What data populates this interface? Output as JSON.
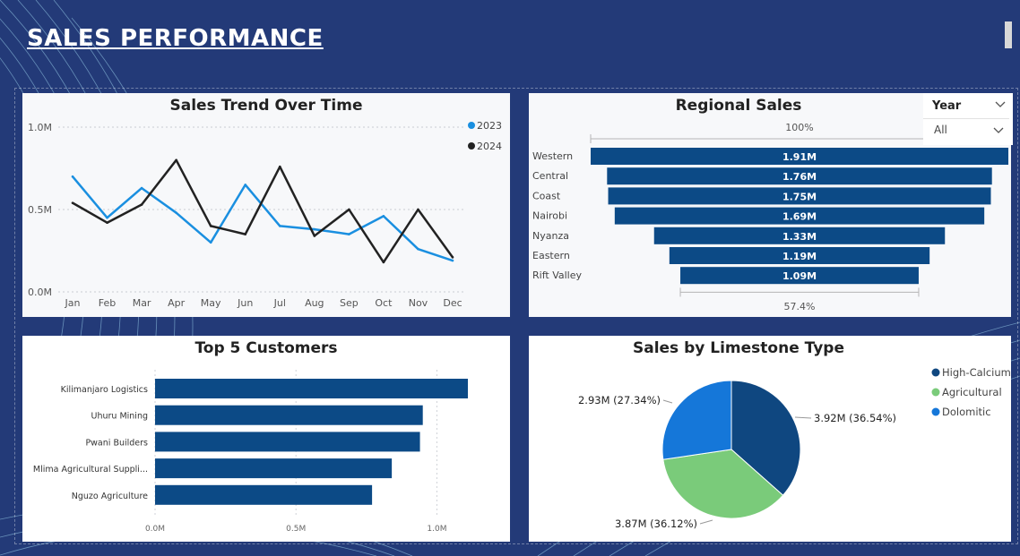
{
  "dashboard": {
    "title": "SALES  PERFORMANCE"
  },
  "colors": {
    "background": "#233a78",
    "dark_blue": "#0c4a86",
    "line_2023": "#1a8fe0",
    "line_2024": "#222222",
    "high_calcium": "#0f4780",
    "agricultural": "#7acb7a",
    "dolomitic": "#1577d9"
  },
  "year_slicer": {
    "title": "Year",
    "value": "All"
  },
  "chart_data": [
    {
      "id": "sales_trend",
      "type": "line",
      "title": "Sales Trend Over Time",
      "categories": [
        "Jan",
        "Feb",
        "Mar",
        "Apr",
        "May",
        "Jun",
        "Jul",
        "Aug",
        "Sep",
        "Oct",
        "Nov",
        "Dec"
      ],
      "series": [
        {
          "name": "2023",
          "values": [
            0.7,
            0.45,
            0.63,
            0.48,
            0.3,
            0.65,
            0.4,
            0.38,
            0.35,
            0.46,
            0.26,
            0.19
          ]
        },
        {
          "name": "2024",
          "values": [
            0.54,
            0.42,
            0.53,
            0.8,
            0.4,
            0.35,
            0.76,
            0.34,
            0.5,
            0.18,
            0.5,
            0.21
          ]
        }
      ],
      "ylim": [
        0,
        1.0
      ],
      "yticks": [
        "1.0M",
        "0.5M",
        "0.0M"
      ],
      "legend": "top-right"
    },
    {
      "id": "regional_sales",
      "type": "bar",
      "orientation": "funnel",
      "title": "Regional Sales",
      "categories": [
        "Western",
        "Central",
        "Coast",
        "Nairobi",
        "Nyanza",
        "Eastern",
        "Rift Valley"
      ],
      "values": [
        1.91,
        1.76,
        1.75,
        1.69,
        1.33,
        1.19,
        1.09
      ],
      "labels": [
        "1.91M",
        "1.76M",
        "1.75M",
        "1.69M",
        "1.33M",
        "1.19M",
        "1.09M"
      ],
      "top_label": "100%",
      "bottom_label": "57.4%"
    },
    {
      "id": "top_customers",
      "type": "bar",
      "orientation": "horizontal",
      "title": "Top 5 Customers",
      "categories": [
        "Kilimanjaro Logistics",
        "Uhuru Mining",
        "Pwani Builders",
        "Mlima Agricultural Suppli...",
        "Nguzo Agriculture"
      ],
      "values": [
        1.11,
        0.95,
        0.94,
        0.84,
        0.77
      ],
      "xlim": [
        0,
        1.25
      ],
      "xticks": [
        "0.0M",
        "0.5M",
        "1.0M"
      ]
    },
    {
      "id": "limestone_type",
      "type": "pie",
      "title": "Sales by Limestone Type",
      "categories": [
        "High-Calcium",
        "Agricultural",
        "Dolomitic"
      ],
      "values": [
        3.92,
        3.87,
        2.93
      ],
      "labels": [
        "3.92M (36.54%)",
        "3.87M (36.12%)",
        "2.93M (27.34%)"
      ],
      "legend": "right"
    }
  ]
}
